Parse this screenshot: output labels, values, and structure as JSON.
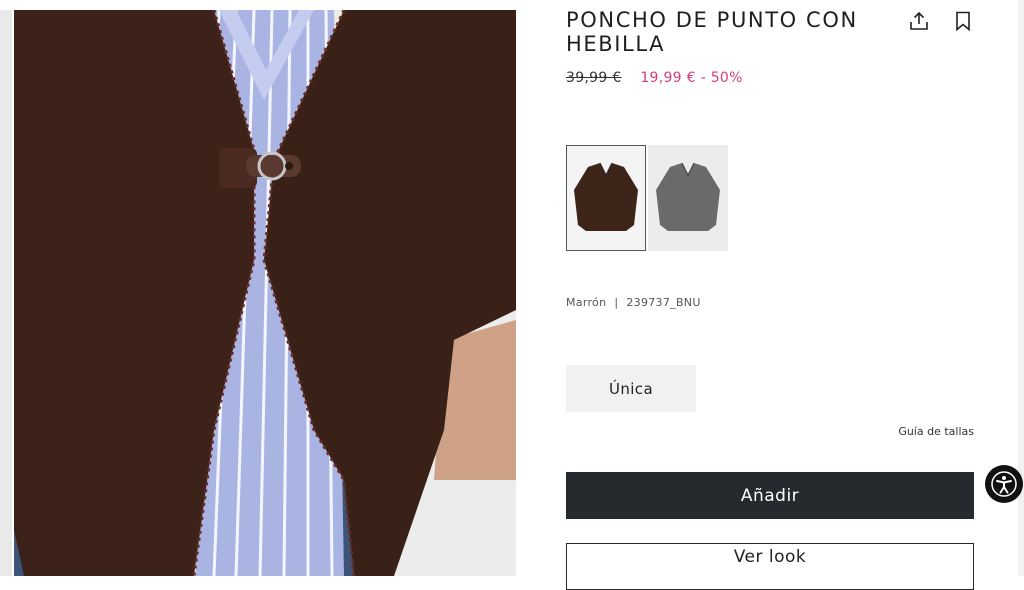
{
  "product": {
    "title_line1": "PONCHO DE PUNTO CON",
    "title_line2": "HEBILLA",
    "old_price": "39,99 €",
    "sale_price": "19,99 €",
    "discount": "- 50%",
    "color_name": "Marrón",
    "separator": "|",
    "reference": "239737_BNU"
  },
  "actions": {
    "share_icon": "share-icon",
    "bookmark_icon": "bookmark-icon"
  },
  "colors": [
    {
      "name": "brown",
      "hex": "#3d2419",
      "selected": true
    },
    {
      "name": "grey",
      "hex": "#6a6a6a",
      "selected": false
    }
  ],
  "sizes": {
    "selected": "Única",
    "guide_label": "Guía de tallas"
  },
  "buttons": {
    "add": "Añadir",
    "look": "Ver look"
  },
  "theme": {
    "sale_color": "#d63d7f",
    "button_dark": "#262a2e"
  }
}
